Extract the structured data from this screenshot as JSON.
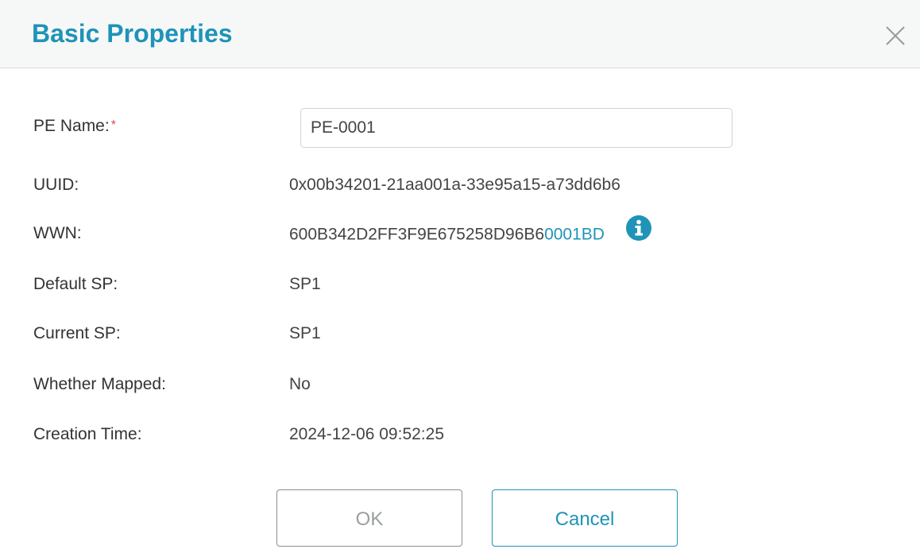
{
  "dialog": {
    "title": "Basic Properties"
  },
  "fields": {
    "pe_name": {
      "label": "PE Name:",
      "required_mark": "*",
      "value": "PE-0001"
    },
    "uuid": {
      "label": "UUID:",
      "value": "0x00b34201-21aa001a-33e95a15-a73dd6b6"
    },
    "wwn": {
      "label": "WWN:",
      "value_prefix": "600B342D2FF3F9E675258D96B6",
      "value_highlight": "0001BD"
    },
    "default_sp": {
      "label": "Default SP:",
      "value": "SP1"
    },
    "current_sp": {
      "label": "Current SP:",
      "value": "SP1"
    },
    "whether_mapped": {
      "label": "Whether Mapped:",
      "value": "No"
    },
    "creation_time": {
      "label": "Creation Time:",
      "value": "2024-12-06 09:52:25"
    }
  },
  "buttons": {
    "ok_label": "OK",
    "cancel_label": "Cancel"
  },
  "icons": {
    "close": "close-icon",
    "info": "info-icon"
  },
  "colors": {
    "accent": "#1f93b8",
    "required": "#e0474c",
    "header_bg": "#f6f8f8"
  }
}
